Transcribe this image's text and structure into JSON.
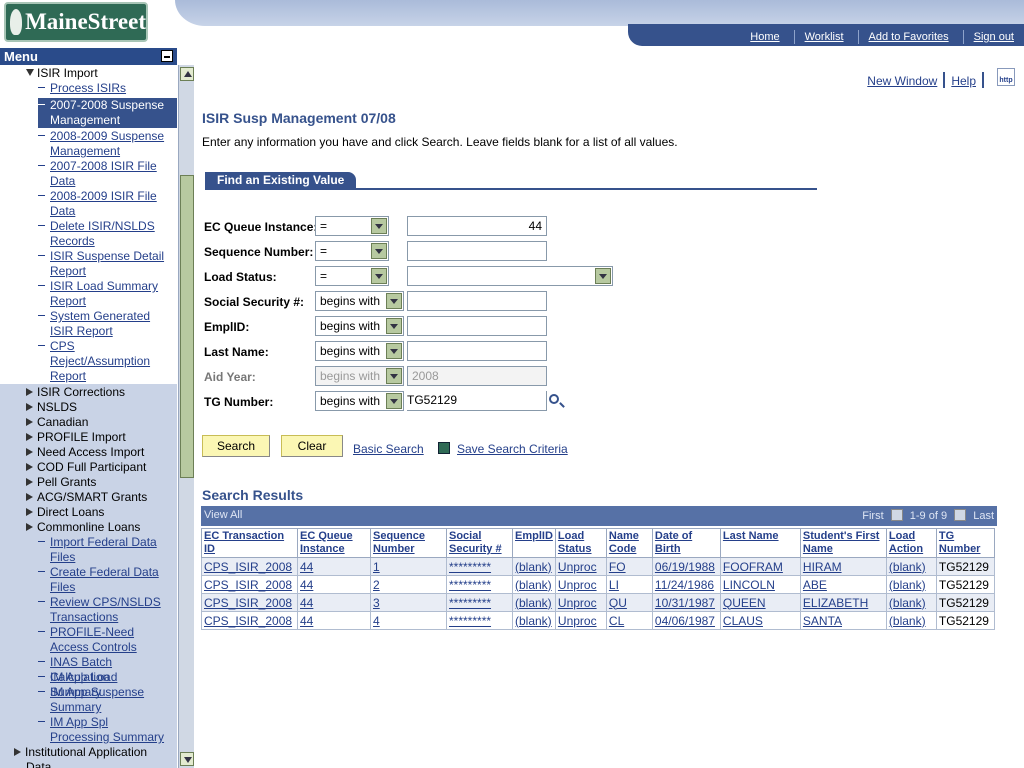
{
  "brand": {
    "logo_text": "MaineStreet"
  },
  "top_links": [
    "Home",
    "Worklist",
    "Add to Favorites",
    "Sign out"
  ],
  "menu": {
    "title": "Menu",
    "items": [
      {
        "label": "ISIR Import",
        "level": "top",
        "expanded": true
      },
      {
        "label": "Process ISIRs",
        "level": "sub"
      },
      {
        "label": "2007-2008 Suspense Management",
        "level": "sub",
        "selected": true
      },
      {
        "label": "2008-2009 Suspense Management",
        "level": "sub"
      },
      {
        "label": "2007-2008 ISIR File Data",
        "level": "sub"
      },
      {
        "label": "2008-2009 ISIR File Data",
        "level": "sub"
      },
      {
        "label": "Delete ISIR/NSLDS Records",
        "level": "sub"
      },
      {
        "label": "ISIR Suspense Detail Report",
        "level": "sub"
      },
      {
        "label": "ISIR Load Summary Report",
        "level": "sub"
      },
      {
        "label": "System Generated ISIR Report",
        "level": "sub"
      },
      {
        "label": "CPS Reject/Assumption Report",
        "level": "sub"
      },
      {
        "label": "ISIR Corrections",
        "level": "top"
      },
      {
        "label": "NSLDS",
        "level": "top"
      },
      {
        "label": "Canadian",
        "level": "top"
      },
      {
        "label": "PROFILE Import",
        "level": "top"
      },
      {
        "label": "Need Access Import",
        "level": "top"
      },
      {
        "label": "COD Full Participant",
        "level": "top"
      },
      {
        "label": "Pell Grants",
        "level": "top"
      },
      {
        "label": "ACG/SMART Grants",
        "level": "top"
      },
      {
        "label": "Direct Loans",
        "level": "top"
      },
      {
        "label": "Commonline Loans",
        "level": "top"
      },
      {
        "label": "Import Federal Data Files",
        "level": "sub"
      },
      {
        "label": "Create Federal Data Files",
        "level": "sub"
      },
      {
        "label": "Review CPS/NSLDS Transactions",
        "level": "sub"
      },
      {
        "label": "PROFILE-Need Access Controls",
        "level": "sub"
      },
      {
        "label": "INAS Batch Calculation",
        "level": "sub"
      },
      {
        "label": "IM App Load Summary",
        "level": "sub"
      },
      {
        "label": "IM App Suspense Summary",
        "level": "sub"
      },
      {
        "label": "IM App Spl Processing Summary",
        "level": "sub"
      },
      {
        "label": "Institutional Application Data",
        "level": "top0"
      }
    ]
  },
  "utility": {
    "new_window": "New Window",
    "help": "Help",
    "http_icon": "http"
  },
  "page": {
    "title": "ISIR Susp Management 07/08",
    "instructions": "Enter any information you have and click Search. Leave fields blank for a list of all values.",
    "tab": "Find an Existing Value"
  },
  "search_fields": [
    {
      "label": "EC Queue Instance:",
      "operator": "=",
      "value": "44",
      "disabled": false
    },
    {
      "label": "Sequence Number:",
      "operator": "=",
      "value": "",
      "disabled": false
    },
    {
      "label": "Load Status:",
      "operator": "=",
      "value": "",
      "disabled": false
    },
    {
      "label": "Social Security #:",
      "operator": "begins with",
      "value": "",
      "disabled": false
    },
    {
      "label": "EmplID:",
      "operator": "begins with",
      "value": "",
      "disabled": false
    },
    {
      "label": "Last Name:",
      "operator": "begins with",
      "value": "",
      "disabled": false
    },
    {
      "label": "Aid Year:",
      "operator": "begins with",
      "value": "2008",
      "disabled": true
    },
    {
      "label": "TG Number:",
      "operator": "begins with",
      "value": "TG52129",
      "disabled": false
    }
  ],
  "buttons": {
    "search": "Search",
    "clear": "Clear",
    "basic_search": "Basic Search",
    "save_criteria": "Save Search Criteria"
  },
  "results": {
    "title": "Search Results",
    "view_all": "View All",
    "first": "First",
    "range": "1-9 of 9",
    "last": "Last",
    "columns": [
      "EC Transaction ID",
      "EC Queue Instance",
      "Sequence Number",
      "Social Security #",
      "EmplID",
      "Load Status",
      "Name Code",
      "Date of Birth",
      "Last Name",
      "Student's First Name",
      "Load Action",
      "TG Number"
    ],
    "rows": [
      [
        "CPS_ISIR_2008",
        "44",
        "1",
        "*********",
        "(blank)",
        "Unproc",
        "FO",
        "06/19/1988",
        "FOOFRAM",
        "HIRAM",
        "(blank)",
        "TG52129"
      ],
      [
        "CPS_ISIR_2008",
        "44",
        "2",
        "*********",
        "(blank)",
        "Unproc",
        "LI",
        "11/24/1986",
        "LINCOLN",
        "ABE",
        "(blank)",
        "TG52129"
      ],
      [
        "CPS_ISIR_2008",
        "44",
        "3",
        "*********",
        "(blank)",
        "Unproc",
        "QU",
        "10/31/1987",
        "QUEEN",
        "ELIZABETH",
        "(blank)",
        "TG52129"
      ],
      [
        "CPS_ISIR_2008",
        "44",
        "4",
        "*********",
        "(blank)",
        "Unproc",
        "CL",
        "04/06/1987",
        "CLAUS",
        "SANTA",
        "(blank)",
        "TG52129"
      ]
    ]
  }
}
